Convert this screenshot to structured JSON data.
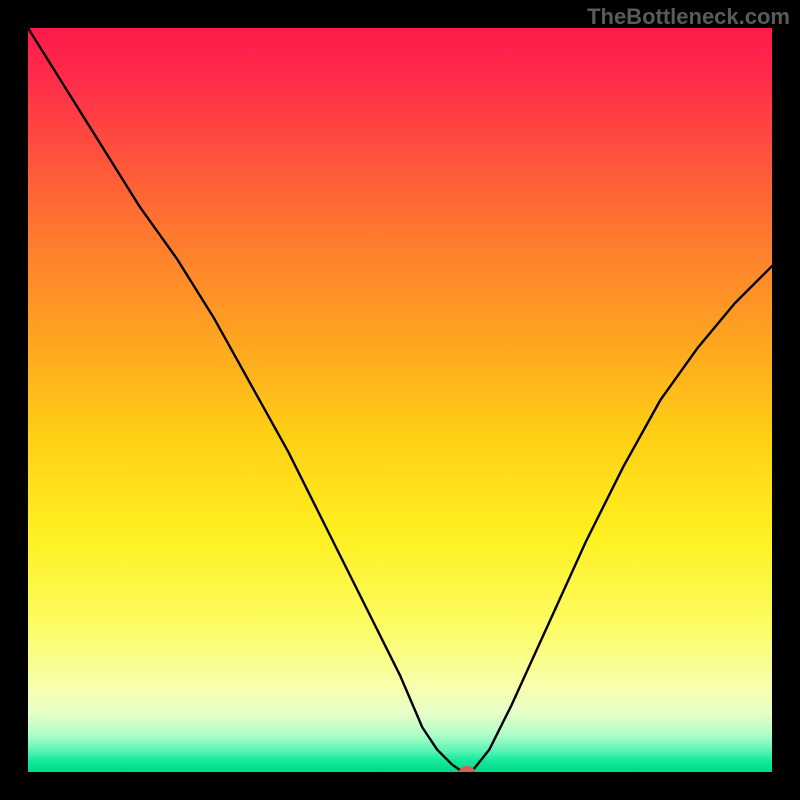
{
  "watermark": "TheBottleneck.com",
  "chart_data": {
    "type": "line",
    "title": "",
    "xlabel": "",
    "ylabel": "",
    "xlim": [
      0,
      100
    ],
    "ylim": [
      0,
      100
    ],
    "grid": false,
    "series": [
      {
        "name": "curve",
        "x": [
          0,
          5,
          10,
          15,
          20,
          25,
          30,
          35,
          40,
          45,
          50,
          53,
          55,
          57,
          58,
          59,
          60,
          62,
          65,
          70,
          75,
          80,
          85,
          90,
          95,
          100
        ],
        "values": [
          100,
          92,
          84,
          76,
          69,
          61,
          52,
          43,
          33,
          23,
          13,
          6,
          3,
          1,
          0.3,
          0,
          0.5,
          3,
          9,
          20,
          31,
          41,
          50,
          57,
          63,
          68
        ]
      }
    ],
    "marker": {
      "x": 59,
      "y": 0
    },
    "background_gradient_stops": [
      {
        "pos": 0,
        "color": "#ff1a4a"
      },
      {
        "pos": 0.15,
        "color": "#ff4a3f"
      },
      {
        "pos": 0.42,
        "color": "#ffa520"
      },
      {
        "pos": 0.68,
        "color": "#fff020"
      },
      {
        "pos": 0.88,
        "color": "#f8ffa8"
      },
      {
        "pos": 0.97,
        "color": "#60f5b8"
      },
      {
        "pos": 1.0,
        "color": "#00d888"
      }
    ]
  }
}
